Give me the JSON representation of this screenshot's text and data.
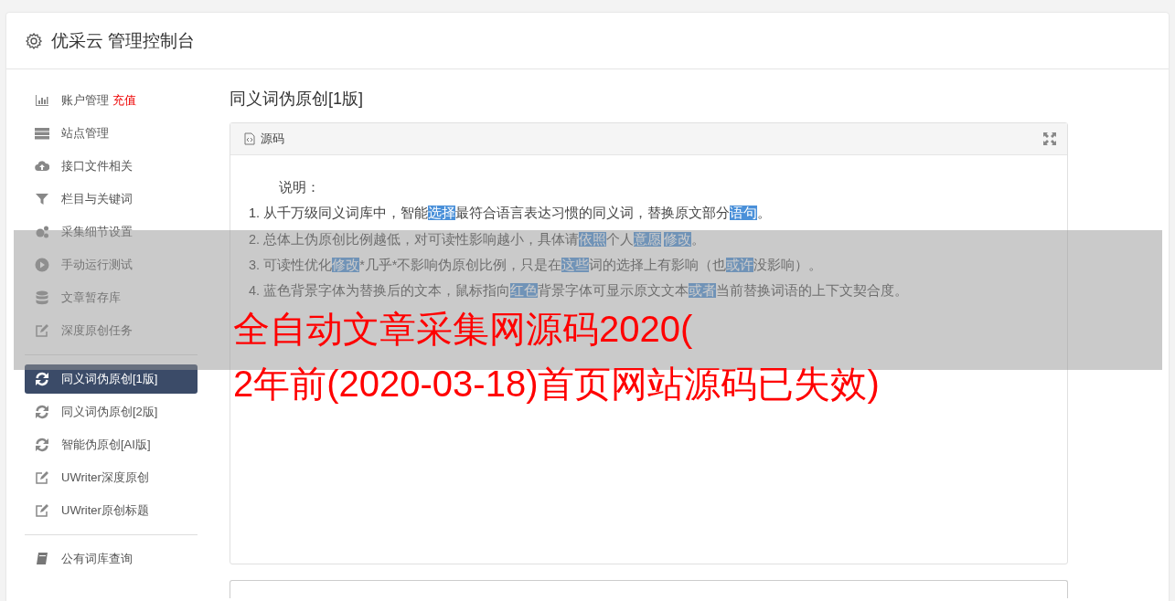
{
  "header": {
    "title": "优采云 管理控制台"
  },
  "sidebar": {
    "groups": [
      {
        "items": [
          {
            "label": "账户管理",
            "badge": "充值",
            "selected": false
          },
          {
            "label": "站点管理",
            "selected": false
          },
          {
            "label": "接口文件相关",
            "selected": false
          },
          {
            "label": "栏目与关键词",
            "selected": false
          },
          {
            "label": "采集细节设置",
            "selected": false
          },
          {
            "label": "手动运行测试",
            "selected": false
          },
          {
            "label": "文章暂存库",
            "selected": false
          },
          {
            "label": "深度原创任务",
            "selected": false
          }
        ]
      },
      {
        "items": [
          {
            "label": "同义词伪原创[1版]",
            "selected": true
          },
          {
            "label": "同义词伪原创[2版]",
            "selected": false
          },
          {
            "label": "智能伪原创[AI版]",
            "selected": false
          },
          {
            "label": "UWriter深度原创",
            "selected": false
          },
          {
            "label": "UWriter原创标题",
            "selected": false
          }
        ]
      },
      {
        "items": [
          {
            "label": "公有词库查询",
            "selected": false
          }
        ]
      }
    ]
  },
  "main": {
    "title": "同义词伪原创[1版]",
    "panel": {
      "title": "源码",
      "intro": "说明：",
      "lines": [
        [
          {
            "text": "1. 从千万级同义词库中，智能",
            "marked": false
          },
          {
            "text": "选择",
            "marked": true
          },
          {
            "text": "最符合语言表达习惯的同义词，替换原文部分",
            "marked": false
          },
          {
            "text": "语句",
            "marked": true
          },
          {
            "text": "。",
            "marked": false
          }
        ],
        [
          {
            "text": "2. 总体上伪原创比例越低，对可读性影响越小，具体请",
            "marked": false
          },
          {
            "text": "依照",
            "marked": true
          },
          {
            "text": "个人",
            "marked": false
          },
          {
            "text": "意愿",
            "marked": true
          },
          {
            "text": "修改",
            "marked": true
          },
          {
            "text": "。",
            "marked": false
          }
        ],
        [
          {
            "text": "3. 可读性优化",
            "marked": false
          },
          {
            "text": "修改",
            "marked": true
          },
          {
            "text": "*几乎*不影响伪原创比例，只是在",
            "marked": false
          },
          {
            "text": "这些",
            "marked": true
          },
          {
            "text": "词的选择上有影响（也",
            "marked": false
          },
          {
            "text": "或许",
            "marked": true
          },
          {
            "text": "没影响）。",
            "marked": false
          }
        ],
        [
          {
            "text": "4. 蓝色背景字体为替换后的文本，鼠标指向",
            "marked": false
          },
          {
            "text": "红色",
            "marked": true
          },
          {
            "text": "背景字体可显示原文文本",
            "marked": false
          },
          {
            "text": "或者",
            "marked": true
          },
          {
            "text": "当前替换词语的上下文契合度。",
            "marked": false
          }
        ]
      ]
    }
  },
  "overlay_banner": {
    "lines": [
      "全自动文章采集网源码2020(",
      "2年前(2020-03-18)首页网站源码已失效)"
    ]
  }
}
